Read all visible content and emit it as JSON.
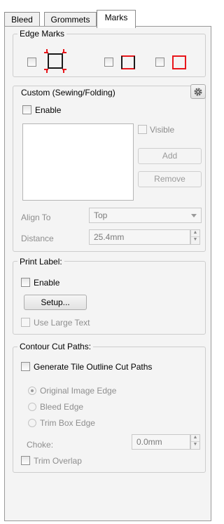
{
  "tabs": [
    "Bleed",
    "Grommets",
    "Marks"
  ],
  "edge_marks": {
    "title": "Edge Marks",
    "checkboxes": [
      false,
      false,
      false
    ]
  },
  "custom": {
    "title": "Custom (Sewing/Folding)",
    "enable_label": "Enable",
    "visible_label": "Visible",
    "add_label": "Add",
    "remove_label": "Remove",
    "align_label": "Align To",
    "align_value": "Top",
    "distance_label": "Distance",
    "distance_value": "25.4mm"
  },
  "print_label": {
    "title": "Print Label:",
    "enable_label": "Enable",
    "setup_label": "Setup...",
    "large_text_label": "Use Large Text"
  },
  "contour": {
    "title": "Contour Cut Paths:",
    "generate_label": "Generate Tile Outline Cut Paths",
    "options": [
      "Original Image Edge",
      "Bleed Edge",
      "Trim Box Edge"
    ],
    "selected_option": 0,
    "choke_label": "Choke:",
    "choke_value": "0.0mm",
    "trim_overlap_label": "Trim Overlap"
  },
  "colors": {
    "mark_red": "#e8161b",
    "mark_black": "#1a1a1a"
  }
}
